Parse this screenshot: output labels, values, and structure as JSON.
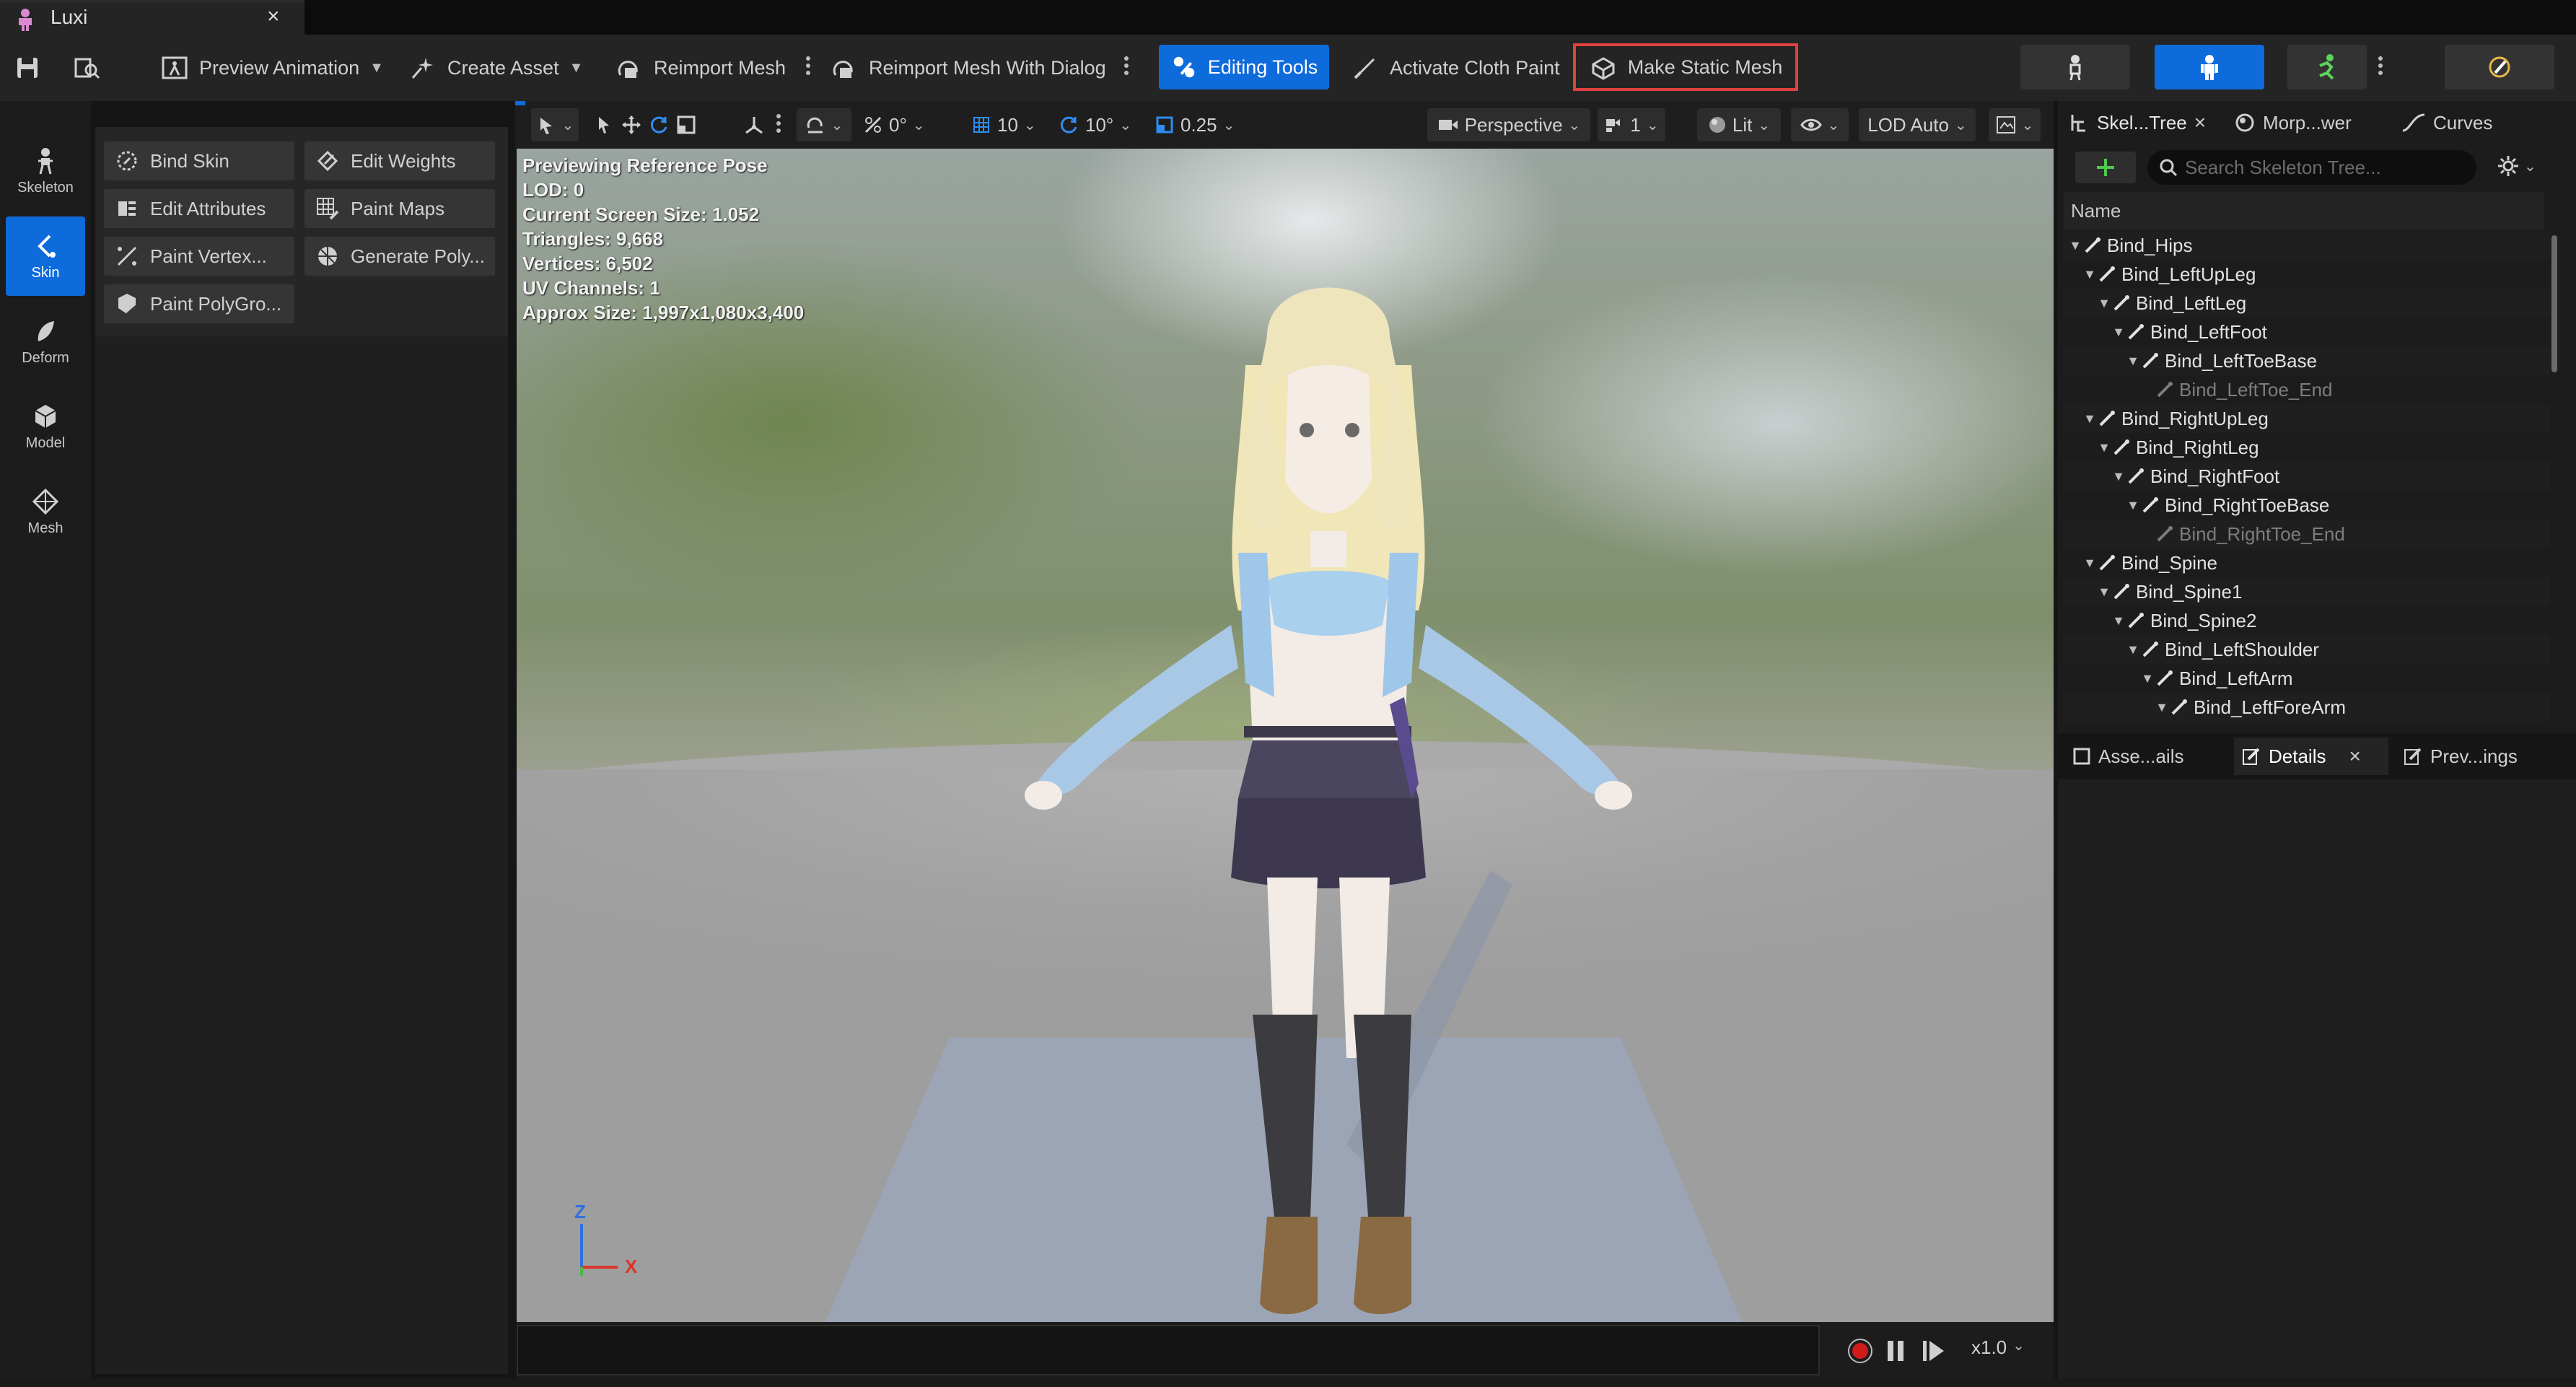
{
  "window": {
    "tab_title": "Luxi",
    "tab_close": "×"
  },
  "toolbar": {
    "preview_animation": "Preview Animation",
    "create_asset": "Create Asset",
    "reimport_mesh": "Reimport Mesh",
    "reimport_mesh_dialog": "Reimport Mesh With Dialog",
    "editing_tools": "Editing Tools",
    "activate_cloth_paint": "Activate Cloth Paint",
    "make_static_mesh": "Make Static Mesh",
    "highlight_color": "#e0413f",
    "accent_color": "#0e6bdb"
  },
  "modes": [
    {
      "label": "Skeleton",
      "icon": "skeleton-icon",
      "active": false
    },
    {
      "label": "Skin",
      "icon": "skin-brush-icon",
      "active": true
    },
    {
      "label": "Deform",
      "icon": "deform-icon",
      "active": false
    },
    {
      "label": "Model",
      "icon": "model-cube-icon",
      "active": false
    },
    {
      "label": "Mesh",
      "icon": "mesh-icon",
      "active": false
    }
  ],
  "tools": [
    {
      "label": "Bind Skin",
      "icon": "bind-skin-icon"
    },
    {
      "label": "Edit Weights",
      "icon": "edit-weights-icon"
    },
    {
      "label": "Edit Attributes",
      "icon": "edit-attributes-icon"
    },
    {
      "label": "Paint Maps",
      "icon": "paint-maps-icon"
    },
    {
      "label": "Paint Vertex...",
      "icon": "paint-vertex-icon"
    },
    {
      "label": "Generate Poly...",
      "icon": "generate-poly-icon"
    },
    {
      "label": "Paint PolyGro...",
      "icon": "paint-polygroup-icon"
    }
  ],
  "viewport_toolbar": {
    "rotation_snap": "0°",
    "grid_snap": "10",
    "angle_snap": "10°",
    "scale_snap": "0.25",
    "perspective": "Perspective",
    "camera_speed": "1",
    "lit": "Lit",
    "lod": "LOD Auto"
  },
  "viewport_stats": [
    "Previewing Reference Pose",
    "LOD: 0",
    "Current Screen Size: 1.052",
    "Triangles: 9,668",
    "Vertices: 6,502",
    "UV Channels: 1",
    "Approx Size: 1,997x1,080x3,400"
  ],
  "axes": {
    "z": "Z",
    "x": "X"
  },
  "playback": {
    "speed": "x1.0"
  },
  "right_panel": {
    "tabs": [
      "Skel...Tree",
      "Morp...wer",
      "Curves"
    ],
    "search_placeholder": "Search Skeleton Tree...",
    "column_name": "Name",
    "bottom_tabs": [
      "Asse...ails",
      "Details",
      "Prev...ings"
    ],
    "close_glyph": "×"
  },
  "skeleton_tree": [
    {
      "name": "Bind_Hips",
      "depth": 0,
      "expanded": true,
      "leaf": false
    },
    {
      "name": "Bind_LeftUpLeg",
      "depth": 1,
      "expanded": true,
      "leaf": false
    },
    {
      "name": "Bind_LeftLeg",
      "depth": 2,
      "expanded": true,
      "leaf": false
    },
    {
      "name": "Bind_LeftFoot",
      "depth": 3,
      "expanded": true,
      "leaf": false
    },
    {
      "name": "Bind_LeftToeBase",
      "depth": 4,
      "expanded": true,
      "leaf": false
    },
    {
      "name": "Bind_LeftToe_End",
      "depth": 5,
      "expanded": false,
      "leaf": true
    },
    {
      "name": "Bind_RightUpLeg",
      "depth": 1,
      "expanded": true,
      "leaf": false
    },
    {
      "name": "Bind_RightLeg",
      "depth": 2,
      "expanded": true,
      "leaf": false
    },
    {
      "name": "Bind_RightFoot",
      "depth": 3,
      "expanded": true,
      "leaf": false
    },
    {
      "name": "Bind_RightToeBase",
      "depth": 4,
      "expanded": true,
      "leaf": false
    },
    {
      "name": "Bind_RightToe_End",
      "depth": 5,
      "expanded": false,
      "leaf": true
    },
    {
      "name": "Bind_Spine",
      "depth": 1,
      "expanded": true,
      "leaf": false
    },
    {
      "name": "Bind_Spine1",
      "depth": 2,
      "expanded": true,
      "leaf": false
    },
    {
      "name": "Bind_Spine2",
      "depth": 3,
      "expanded": true,
      "leaf": false
    },
    {
      "name": "Bind_LeftShoulder",
      "depth": 4,
      "expanded": true,
      "leaf": false
    },
    {
      "name": "Bind_LeftArm",
      "depth": 5,
      "expanded": true,
      "leaf": false
    },
    {
      "name": "Bind_LeftForeArm",
      "depth": 6,
      "expanded": true,
      "leaf": false
    }
  ]
}
